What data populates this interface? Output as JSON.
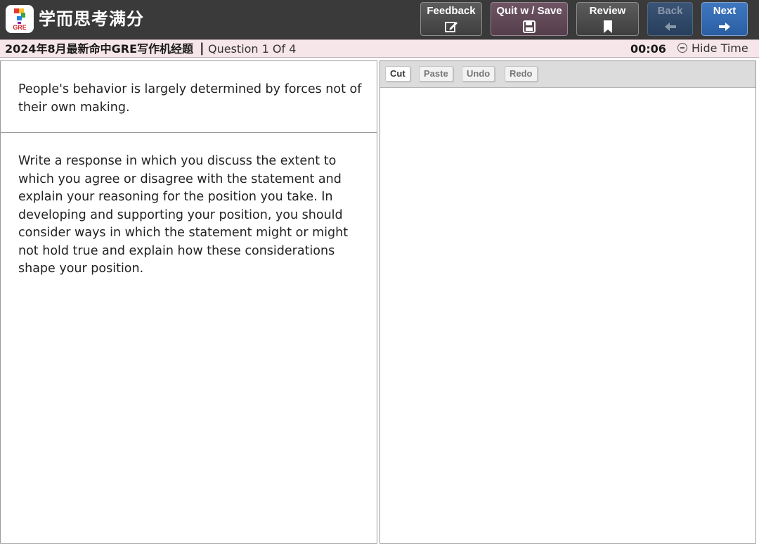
{
  "header": {
    "logo_text": "GRE",
    "brand": "学而思考满分",
    "buttons": {
      "feedback": "Feedback",
      "quit_save": "Quit w / Save",
      "review": "Review",
      "back": "Back",
      "next": "Next"
    }
  },
  "subbar": {
    "exam_title": "2024年8月最新命中GRE写作机经题",
    "separator": "|",
    "question_count": "Question 1 Of 4",
    "timer": "00:06",
    "hide_time": "Hide Time"
  },
  "question": {
    "prompt": "People's behavior is largely determined by forces not of their own making.",
    "instructions": "Write a response in which you discuss the extent to which you agree or disagree with the statement and explain your reasoning for the position you take. In developing and supporting your position, you should consider ways in which the statement might or might not hold true and explain how these considerations shape your position."
  },
  "editor": {
    "toolbar": {
      "cut": "Cut",
      "paste": "Paste",
      "undo": "Undo",
      "redo": "Redo"
    },
    "value": ""
  },
  "colors": {
    "topbar_bg": "#3a3a3a",
    "subbar_bg": "#f6e6ea",
    "next_button": "#2a5ea3",
    "quit_button": "#553e4b",
    "logo_red": "#d8262c"
  }
}
